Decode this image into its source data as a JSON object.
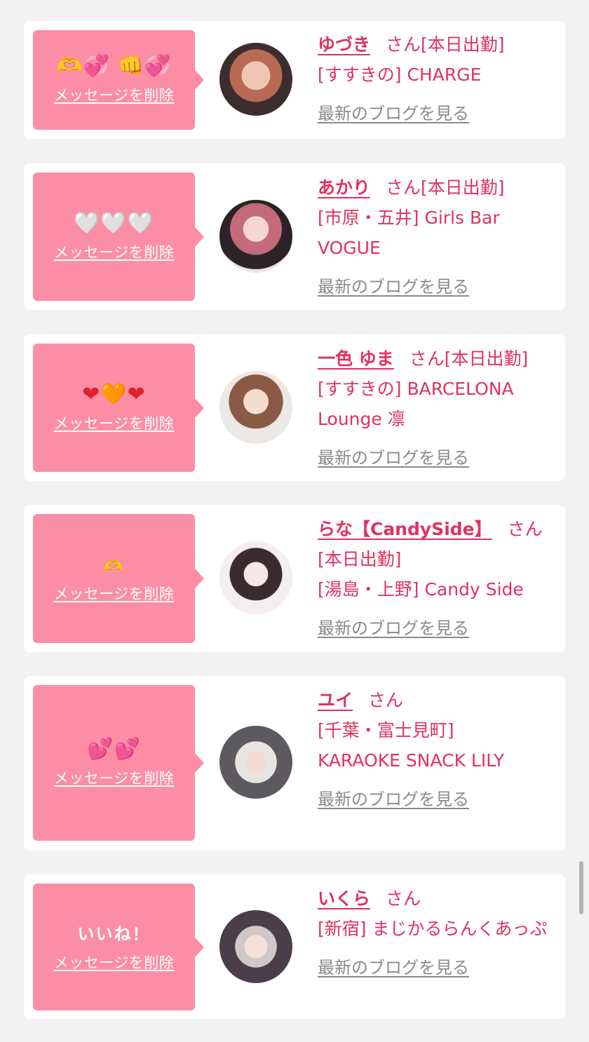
{
  "common": {
    "delete_label": "メッセージを削除",
    "blog_label": "最新のブログを見る",
    "san": "さん"
  },
  "colors": {
    "accent": "#e0325f",
    "bubble": "#fb8ea5",
    "page_bg": "#f2f2f2",
    "card_bg": "#ffffff",
    "link_gray": "#8a8a8a"
  },
  "messages": [
    {
      "reaction_icons": [
        "heart-hands-icon",
        "two-hearts-icon",
        "fist-icon",
        "two-hearts-icon"
      ],
      "name": "ゆづき",
      "status": "[本日出勤]",
      "area": "[すすきの]",
      "shop": "CHARGE"
    },
    {
      "reaction_icons": [
        "white-heart-icon",
        "white-heart-icon",
        "white-heart-icon"
      ],
      "name": "あかり",
      "status": "[本日出勤]",
      "area": "[市原・五井]",
      "shop": "Girls Bar VOGUE"
    },
    {
      "reaction_icons": [
        "red-heart-icon",
        "orange-heart-icon",
        "red-heart-icon"
      ],
      "name": "一色 ゆま",
      "status": "[本日出勤]",
      "area": "[すすきの]",
      "shop": "BARCELONA Lounge 凛"
    },
    {
      "reaction_icons": [
        "heart-hands-icon"
      ],
      "name": "らな【CandySide】",
      "status": "[本日出勤]",
      "area": "[湯島・上野]",
      "shop": "Candy Side"
    },
    {
      "reaction_icons": [
        "two-hearts-icon",
        "two-hearts-icon"
      ],
      "name": "ユイ",
      "status": "",
      "area": "[千葉・富士見町]",
      "shop": "KARAOKE SNACK LILY"
    },
    {
      "reaction_text": "いいね！",
      "name": "いくら",
      "status": "",
      "area": "[新宿]",
      "shop": "まじかるらんくあっぷ"
    }
  ]
}
